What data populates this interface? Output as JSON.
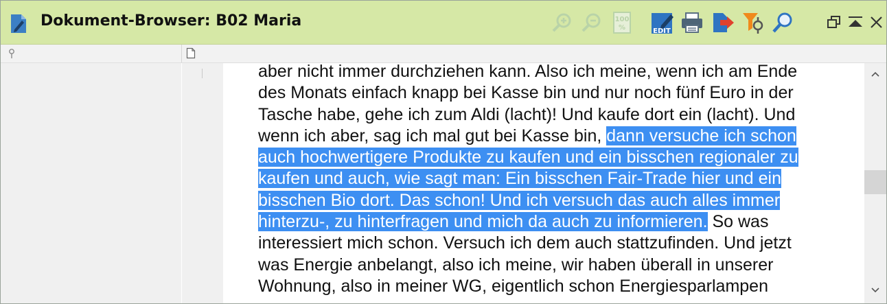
{
  "window": {
    "title": "Dokument-Browser: B02 Maria",
    "title_bar_color": "#d6e8a6",
    "toolbar_icons": [
      "zoom-in-icon",
      "zoom-out-icon",
      "zoom-100-icon",
      "edit-icon",
      "print-icon",
      "export-icon",
      "filter-icon",
      "search-icon",
      "restore-window-icon",
      "collapse-icon",
      "close-icon"
    ],
    "edit_label": "EDIT",
    "zoom_100_label": "100 %"
  },
  "document": {
    "text_before": "aber nicht immer durchziehen kann. Also ich meine, wenn ich am Ende\ndes Monats einfach knapp bei Kasse bin und nur noch fünf Euro in der\nTasche habe, gehe ich zum Aldi (lacht)! Und kaufe dort ein (lacht). Und\nwenn ich aber, sag ich mal gut bei Kasse bin, ",
    "text_highlighted": "dann versuche ich schon\nauch hochwertigere Produkte zu kaufen und ein bisschen regionaler zu\nkaufen und auch, wie sagt man: Ein bisschen Fair-Trade hier und ein\nbisschen Bio dort. Das schon! Und ich versuch das auch alles immer\nhinterzu-, zu hinterfragen und mich da auch zu informieren.",
    "text_after": " So was\ninteressiert mich schon. Versuch ich dem auch stattzufinden. Und jetzt\nwas Energie anbelangt, also ich meine, wir haben überall in unserer\nWohnung, also in meiner WG, eigentlich schon Energiesparlampen",
    "highlight_color": "#3d8ff2"
  }
}
